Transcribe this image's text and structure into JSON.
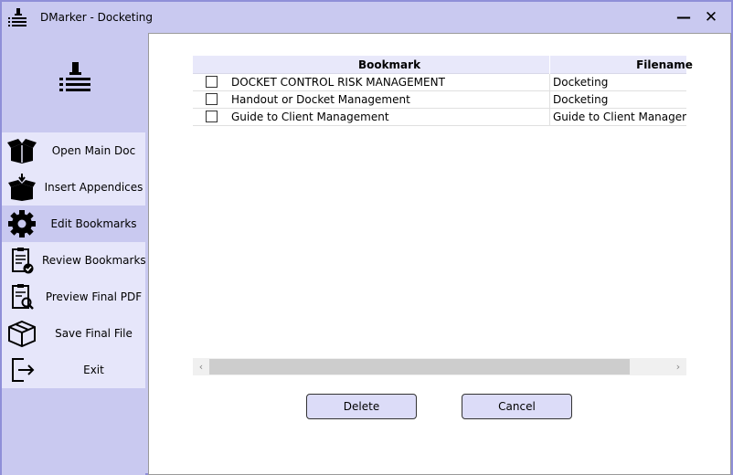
{
  "window": {
    "title": "DMarker - Docketing",
    "minimize_label": "—",
    "close_label": "✕"
  },
  "sidebar": {
    "logo_icon": "bookmark-list-icon",
    "items": [
      {
        "label": "Open Main Doc",
        "icon": "open-box-icon",
        "active": false
      },
      {
        "label": "Insert Appendices",
        "icon": "insert-box-icon",
        "active": false
      },
      {
        "label": "Edit Bookmarks",
        "icon": "gear-icon",
        "active": true
      },
      {
        "label": "Review Bookmarks",
        "icon": "clipboard-check-icon",
        "active": false
      },
      {
        "label": "Preview Final PDF",
        "icon": "clipboard-search-icon",
        "active": false
      },
      {
        "label": "Save Final File",
        "icon": "package-icon",
        "active": false
      },
      {
        "label": "Exit",
        "icon": "exit-icon",
        "active": false
      }
    ]
  },
  "grid": {
    "columns": [
      "Bookmark",
      "Filename"
    ],
    "rows": [
      {
        "checked": false,
        "bookmark": "DOCKET CONTROL RISK MANAGEMENT",
        "filename": "Docketing"
      },
      {
        "checked": false,
        "bookmark": "Handout or Docket Management",
        "filename": "Docketing"
      },
      {
        "checked": false,
        "bookmark": "Guide to Client Management",
        "filename": "Guide to Client Management"
      }
    ]
  },
  "scrollbar": {
    "left_arrow": "‹",
    "right_arrow": "›"
  },
  "buttons": {
    "delete": "Delete",
    "cancel": "Cancel"
  },
  "colors": {
    "chrome": "#c9c9f0",
    "menu_bg": "#e6e6fa",
    "border": "#8f8fd8"
  }
}
